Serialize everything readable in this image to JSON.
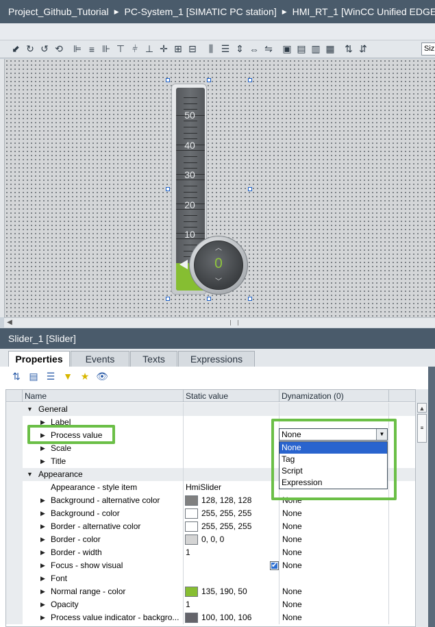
{
  "breadcrumb": [
    "Project_Github_Tutorial",
    "PC-System_1 [SIMATIC PC station]",
    "HMI_RT_1 [WinCC Unified EDGE"
  ],
  "toolbar": {
    "size_field": "Siz"
  },
  "slider_widget": {
    "scale_labels": [
      "50",
      "40",
      "30",
      "20",
      "10"
    ],
    "value": "0",
    "scale_max": 55,
    "current_value": 0,
    "fill_color": "#86be32"
  },
  "section_title": "Slider_1 [Slider]",
  "tabs": [
    "Properties",
    "Events",
    "Texts",
    "Expressions"
  ],
  "grid": {
    "headers": [
      "Name",
      "Static value",
      "Dynamization (0)"
    ],
    "rows": [
      {
        "name": "General",
        "level": 0,
        "expanded": true,
        "section": true,
        "value": "",
        "dyn": ""
      },
      {
        "name": "Label",
        "level": 1,
        "value": "",
        "dyn": ""
      },
      {
        "name": "Process value",
        "level": 1,
        "value": "",
        "dyn": ""
      },
      {
        "name": "Scale",
        "level": 1,
        "value": "",
        "dyn": ""
      },
      {
        "name": "Title",
        "level": 1,
        "value": "",
        "dyn": ""
      },
      {
        "name": "Appearance",
        "level": 0,
        "expanded": true,
        "section": true,
        "value": "",
        "dyn": ""
      },
      {
        "name": "Appearance - style item",
        "level": 2,
        "value": "HmiSlider",
        "dyn": ""
      },
      {
        "name": "Background - alternative color",
        "level": 1,
        "swatch": "#808080",
        "value": "128, 128, 128",
        "dyn": "None"
      },
      {
        "name": "Background - color",
        "level": 1,
        "swatch": "#ffffff",
        "value": "255, 255, 255",
        "dyn": "None"
      },
      {
        "name": "Border - alternative color",
        "level": 1,
        "swatch": "#ffffff",
        "value": "255, 255, 255",
        "dyn": "None"
      },
      {
        "name": "Border - color",
        "level": 1,
        "swatch": "#d4d4d4",
        "value": "0, 0, 0",
        "dyn": "None"
      },
      {
        "name": "Border - width",
        "level": 1,
        "value": "1",
        "dyn": "None"
      },
      {
        "name": "Focus - show visual",
        "level": 1,
        "value": "",
        "checked": true,
        "dyn": "None"
      },
      {
        "name": "Font",
        "level": 1,
        "value": "",
        "dyn": ""
      },
      {
        "name": "Normal range - color",
        "level": 1,
        "swatch": "#87be32",
        "value": "135, 190, 50",
        "dyn": "None"
      },
      {
        "name": "Opacity",
        "level": 1,
        "value": "1",
        "dyn": "None"
      },
      {
        "name": "Process value indicator - backgro...",
        "level": 1,
        "swatch": "#64646a",
        "value": "100, 100, 106",
        "dyn": "None"
      }
    ]
  },
  "dynamization_dropdown": {
    "selected": "None",
    "options": [
      "None",
      "Tag",
      "Script",
      "Expression"
    ],
    "highlighted_index": 0
  },
  "colors": {
    "header_bg": "#4a5b6b",
    "highlight": "#6bbf47",
    "selection": "#2964ce"
  }
}
